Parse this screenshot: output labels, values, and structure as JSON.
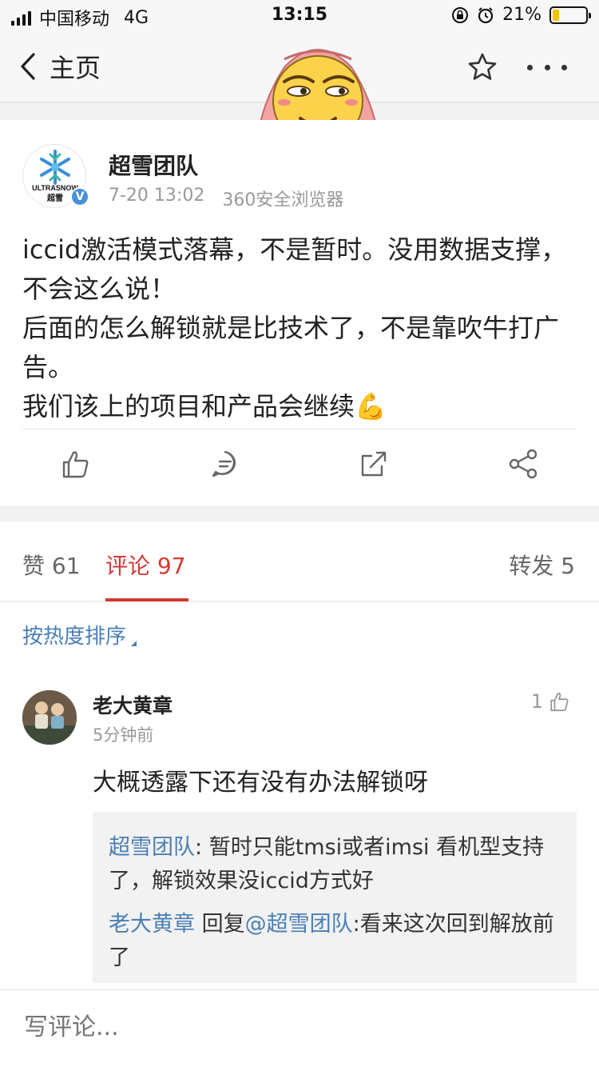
{
  "status_bar": {
    "carrier": "中国移动",
    "network": "4G",
    "time": "13:15",
    "battery": "21%",
    "battery_level": 0.21
  },
  "nav": {
    "back_label": "主页",
    "icons": [
      "chevron-left-icon",
      "star-icon",
      "more-icon"
    ]
  },
  "post": {
    "author": "超雪团队",
    "verified_mark": "V",
    "time": "7-20 13:02",
    "source": "360安全浏览器",
    "text": "iccid激活模式落幕，不是暂时。没用数据支撑，不会这么说！\n后面的怎么解锁就是比技术了，不是靠吹牛打广告。\n我们该上的项目和产品会继续💪",
    "logo_text": "ULTRASNOW",
    "logo_subtext": "超雪",
    "actions": [
      "thumbs-up-icon",
      "comment-icon",
      "repost-icon",
      "share-icon"
    ]
  },
  "tabs": {
    "likes": "赞 61",
    "comments": "评论 97",
    "reposts": "转发 5"
  },
  "comments": {
    "sort_label": "按热度排序",
    "items": [
      {
        "name": "老大黄章",
        "time": "5分钟前",
        "likes": "1",
        "text": "大概透露下还有没有办法解锁呀",
        "replies": [
          {
            "user": "超雪团队",
            "sep": ":",
            "text": " 暂时只能tmsi或者imsi 看机型支持了，解锁效果没iccid方式好"
          },
          {
            "user": "老大黄章",
            "mid": " 回复",
            "mention": "@超雪团队",
            "text": ":看来这次回到解放前了"
          }
        ]
      }
    ]
  },
  "input": {
    "placeholder": "写评论..."
  },
  "colors": {
    "accent": "#d33a31",
    "link": "#4a7fb5",
    "background": "#f2f2f2"
  }
}
